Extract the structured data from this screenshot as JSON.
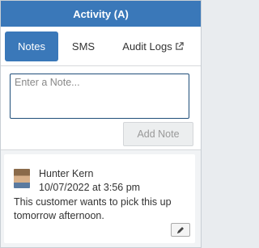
{
  "header": {
    "title": "Activity (A)"
  },
  "tabs": [
    {
      "label": "Notes",
      "active": true
    },
    {
      "label": "SMS",
      "active": false
    },
    {
      "label": "Audit Logs",
      "active": false,
      "icon": "external-link-icon"
    }
  ],
  "compose": {
    "placeholder": "Enter a Note...",
    "value": "",
    "add_label": "Add Note"
  },
  "notes": [
    {
      "author": "Hunter Kern",
      "timestamp": "10/07/2022 at 3:56 pm",
      "text": "This customer wants to pick this up tomorrow afternoon.",
      "edit_icon": "pencil-icon"
    }
  ],
  "colors": {
    "accent": "#3a78b9",
    "input_border": "#1f4e79",
    "background": "#f1f3f5"
  }
}
